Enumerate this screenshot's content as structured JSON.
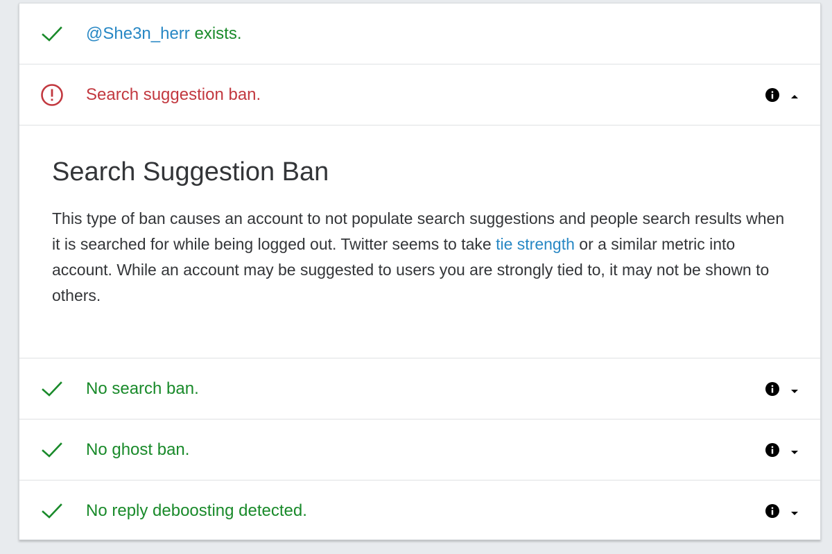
{
  "rows": {
    "exists": {
      "username": "@She3n_herr",
      "suffix": " exists.",
      "status": "ok",
      "icon": "check-icon"
    },
    "suggestion_ban": {
      "label": "Search suggestion ban.",
      "status": "error",
      "icon": "exclamation-circle-icon",
      "expanded": true
    },
    "search_ban": {
      "label": "No search ban.",
      "status": "ok",
      "icon": "check-icon"
    },
    "ghost_ban": {
      "label": "No ghost ban.",
      "status": "ok",
      "icon": "check-icon"
    },
    "reply_deboosting": {
      "label": "No reply deboosting detected.",
      "status": "ok",
      "icon": "check-icon"
    }
  },
  "details": {
    "title": "Search Suggestion Ban",
    "text_before_link": "This type of ban causes an account to not populate search suggestions and people search results when it is searched for while being logged out. Twitter seems to take ",
    "link_text": "tie strength",
    "text_after_link": " or a similar metric into account. While an account may be suggested to users you are strongly tied to, it may not be shown to others."
  },
  "colors": {
    "ok": "#198a2a",
    "error": "#c2383f",
    "link": "#2787c4",
    "text": "#333538",
    "background": "#e8ebee"
  }
}
